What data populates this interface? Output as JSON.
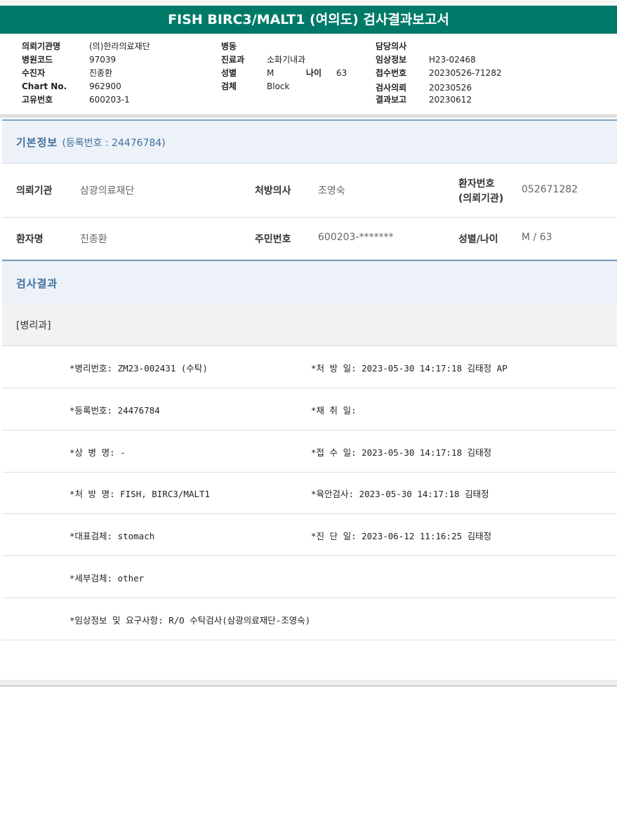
{
  "report": {
    "title": "FISH BIRC3/MALT1 (여의도) 검사결과보고서"
  },
  "header": {
    "col1": [
      {
        "label": "의뢰기관명",
        "value": "(의)한라의료재단"
      },
      {
        "label": "병원코드",
        "value": "97039"
      },
      {
        "label": "수진자",
        "value": "진종환"
      },
      {
        "label": "Chart No.",
        "value": "962900"
      },
      {
        "label": "고유번호",
        "value": "600203-1"
      }
    ],
    "col2": [
      {
        "label": "병동",
        "value": ""
      },
      {
        "label": "진료과",
        "value": "소화기내과"
      },
      {
        "label": "성별",
        "value": "M"
      },
      {
        "label": "검체",
        "value": "Block"
      }
    ],
    "age_label": "나이",
    "age_value": "63",
    "col3": [
      {
        "label": "담당의사",
        "value": ""
      },
      {
        "label": "임상정보",
        "value": "H23-02468"
      },
      {
        "label": "접수번호",
        "value": "20230526-71282"
      },
      {
        "label": "검사의뢰",
        "value": "20230526"
      },
      {
        "label": "결과보고",
        "value": "20230612"
      }
    ]
  },
  "basic_info": {
    "title": "기본정보",
    "subtitle": "(등록번호 : 24476784)",
    "rows": [
      [
        {
          "label": "의뢰기관",
          "value": "삼광의료재단"
        },
        {
          "label": "처방의사",
          "value": "조영숙"
        },
        {
          "label_line1": "환자번호",
          "label_line2": "(의뢰기관)",
          "value": "052671282"
        }
      ],
      [
        {
          "label": "환자명",
          "value": "진종환"
        },
        {
          "label": "주민번호",
          "value": "600203-*******"
        },
        {
          "label": "성별/나이",
          "value": "M / 63"
        }
      ]
    ]
  },
  "results": {
    "title": "검사결과",
    "department": "[병리과]",
    "rows": [
      {
        "left": "*병리번호: ZM23-002431 (수탁)",
        "right": "*처 방 일: 2023-05-30 14:17:18  김태정 AP"
      },
      {
        "left": "*등록번호: 24476784",
        "right": "*채 취 일:"
      },
      {
        "left": "*상 병 명: -",
        "right": "*접 수 일: 2023-05-30 14:17:18  김태정"
      },
      {
        "left": "*처 방 명: FISH, BIRC3/MALT1",
        "right": "*육안검사: 2023-05-30 14:17:18  김태정"
      },
      {
        "left": "*대표검체: stomach",
        "right": "*진 단 일: 2023-06-12 11:16:25  김태정"
      },
      {
        "left": "*세부검체: other",
        "right": ""
      },
      {
        "left": "*임상정보 및 요구사항: R/O 수탁검사(삼광의료재단-조영숙)",
        "right": ""
      }
    ]
  }
}
